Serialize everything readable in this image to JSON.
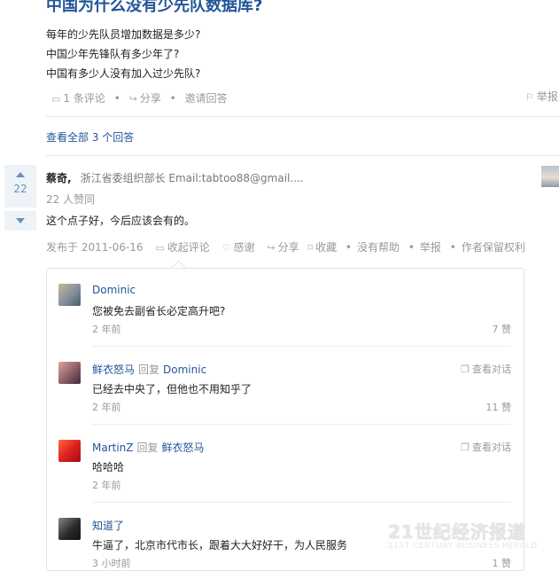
{
  "question": {
    "title": "中国为什么没有少先队数据库?",
    "lines": [
      "每年的少先队员增加数据是多少?",
      "中国少年先锋队有多少年了?",
      "中国有多少人没有加入过少先队?"
    ],
    "actions": {
      "comments": "1 条评论",
      "share": "分享",
      "invite": "邀请回答",
      "report": "举报"
    }
  },
  "view_all": "查看全部 3 个回答",
  "answer": {
    "votes": "22",
    "author_name": "蔡奇,",
    "author_bio": "浙江省委组织部长 Email:tabtoo88@gmail....",
    "likes": "22 人赞同",
    "content": "这个点子好，今后应该会有的。",
    "meta": {
      "date": "发布于 2011-06-16",
      "collapse": "收起评论",
      "thanks": "感谢",
      "share": "分享",
      "favorite": "收藏",
      "unhelpful": "没有帮助",
      "report": "举报",
      "copyright": "作者保留权利"
    }
  },
  "comments": [
    {
      "name": "Dominic",
      "reply_word": "",
      "reply_to": "",
      "text": "您被免去副省长必定高升吧?",
      "time": "2 年前",
      "likes": "7 赞",
      "convo": ""
    },
    {
      "name": "鲜衣怒马",
      "reply_word": "回复",
      "reply_to": "Dominic",
      "text": "已经去中央了，但他也不用知乎了",
      "time": "2 年前",
      "likes": "11 赞",
      "convo": "查看对话"
    },
    {
      "name": "MartinZ",
      "reply_word": "回复",
      "reply_to": "鲜衣怒马",
      "text": "哈哈哈",
      "time": "2 年前",
      "likes": "",
      "convo": "查看对话"
    },
    {
      "name": "知道了",
      "reply_word": "",
      "reply_to": "",
      "text": "牛逼了，北京市代市长，跟着大大好好干，为人民服务",
      "time": "3 小时前",
      "likes": "1 赞",
      "convo": ""
    }
  ],
  "watermark": {
    "cn": "21世纪经济报道",
    "en": "21ST CENTURY BUSINESS HERALD"
  },
  "icons": {
    "comment": "comment-icon",
    "share": "share-icon",
    "flag": "flag-icon",
    "heart": "heart-icon",
    "bookmark": "bookmark-icon",
    "convo": "conversation-icon"
  },
  "colors": {
    "link": "#225599",
    "muted": "#999999",
    "vote_bg": "#eef3f8"
  }
}
